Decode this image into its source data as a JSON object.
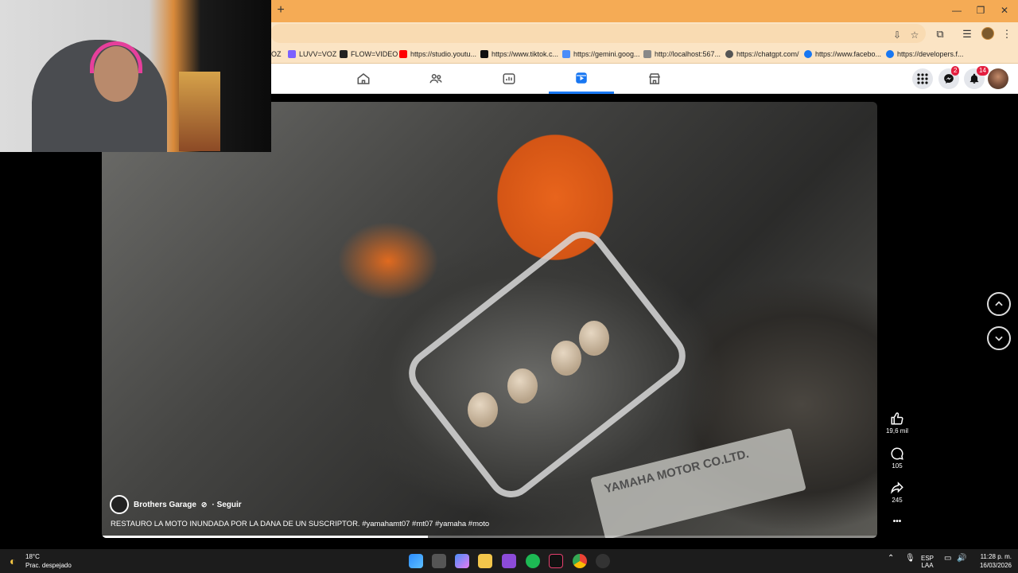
{
  "browser": {
    "new_tab_label": "+",
    "window_controls": {
      "minimize": "—",
      "restore": "❐",
      "close": "✕"
    }
  },
  "bookmarks": [
    {
      "label": "OZ",
      "color": "#ccc"
    },
    {
      "label": "LUVV=VOZ",
      "color": "#7b61ff"
    },
    {
      "label": "FLOW=VIDEO",
      "color": "#222222"
    },
    {
      "label": "https://studio.youtu...",
      "color": "#ff0000"
    },
    {
      "label": "https://www.tiktok.c...",
      "color": "#111111"
    },
    {
      "label": "https://gemini.goog...",
      "color": "#4b8df8"
    },
    {
      "label": "http://localhost:567...",
      "color": "#888888"
    },
    {
      "label": "https://chatgpt.com/",
      "color": "#555555"
    },
    {
      "label": "https://www.facebo...",
      "color": "#1877f2"
    },
    {
      "label": "https://developers.f...",
      "color": "#1877f2"
    }
  ],
  "facebook": {
    "nav_tabs": [
      "home-icon",
      "friends-icon",
      "watch-icon",
      "reels-icon",
      "marketplace-icon"
    ],
    "active_tab": "reels-icon",
    "messenger_badge": "2",
    "notifications_badge": "14"
  },
  "reel": {
    "owner": "Brothers Garage",
    "follow_label": "· Seguir",
    "caption": "RESTAURO LA MOTO INUNDADA POR LA DANA DE UN SUSCRIPTOR. #yamahamt07 #mt07 #yamaha #moto",
    "likes": "19,6 mil",
    "comments": "105",
    "shares": "245",
    "more_label": "•••",
    "progress": 0.42,
    "plate_text": "YAMAHA MOTOR CO.LTD."
  },
  "taskbar": {
    "temperature": "18°C",
    "weather": "Prac. despejado",
    "language": "ESP",
    "layout": "LAA",
    "time": "11:28 p. m.",
    "date": "16/03/2026"
  },
  "colors": {
    "chrome_orange": "#f5ab55",
    "facebook_blue": "#1877f2",
    "badge_red": "#e41e3f"
  }
}
